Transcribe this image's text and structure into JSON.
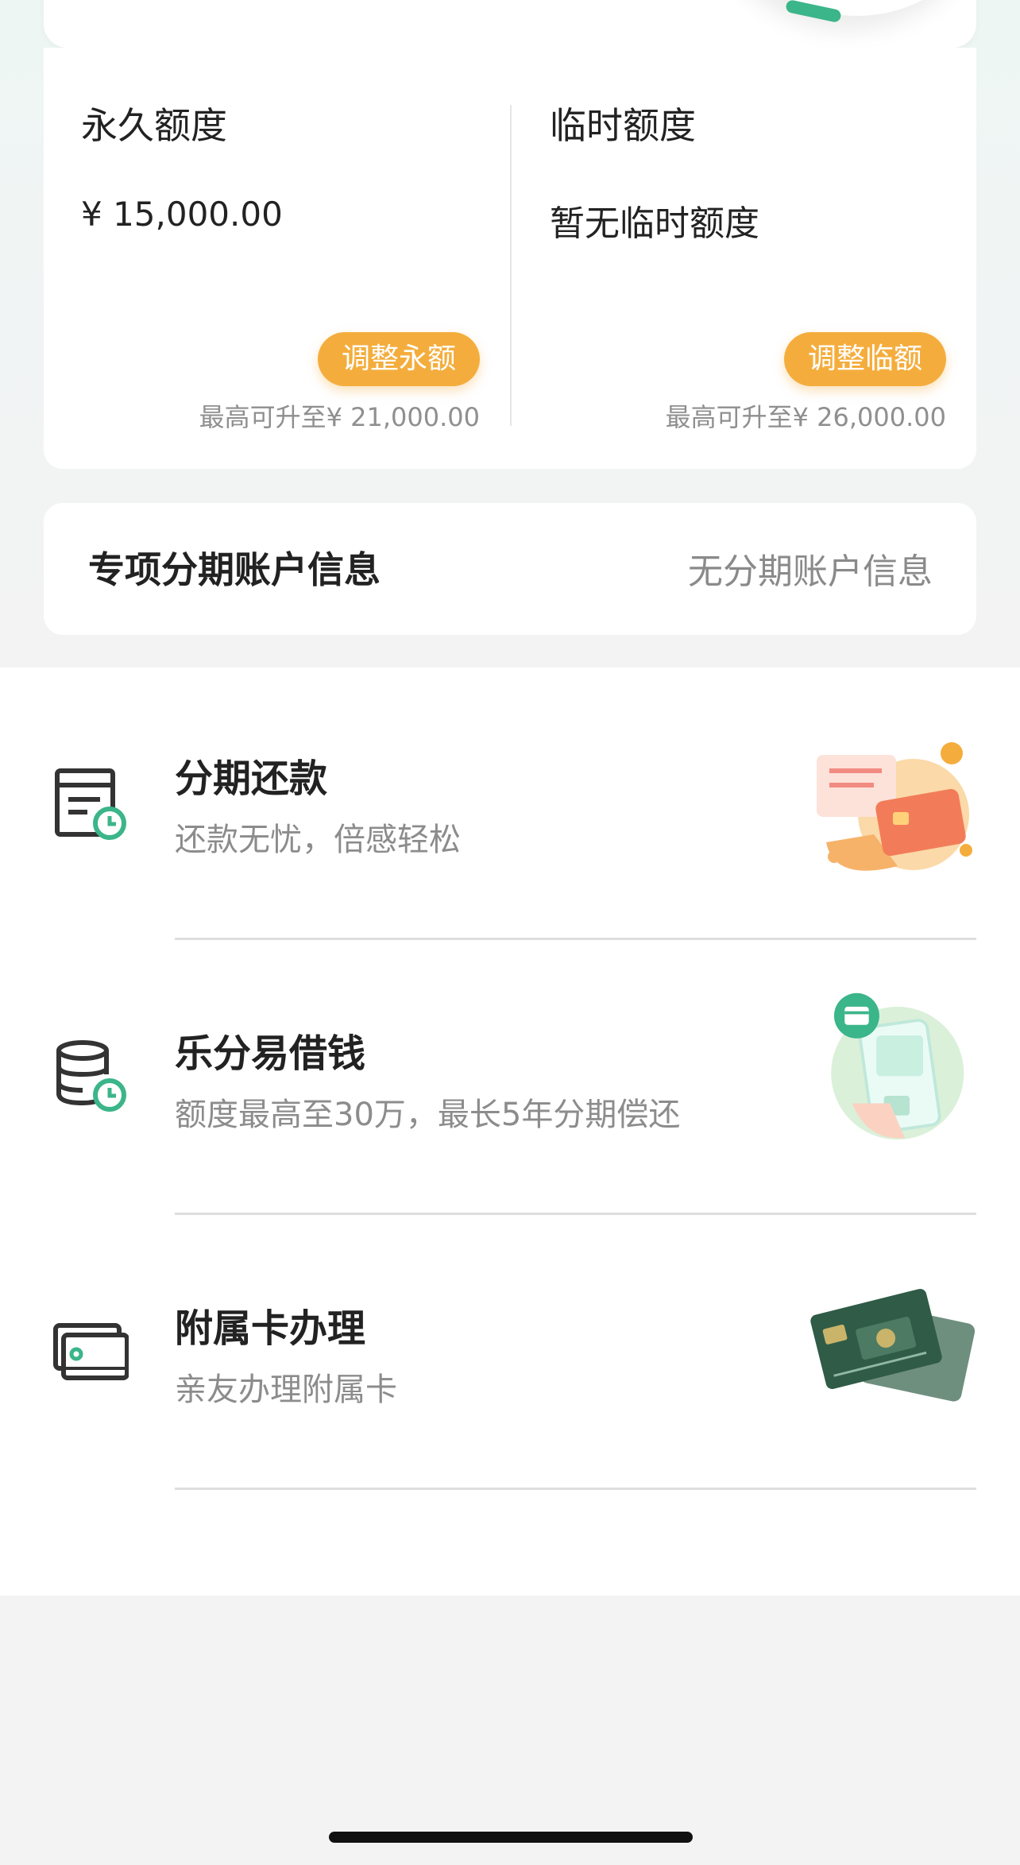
{
  "limits": {
    "permanent": {
      "title": "永久额度",
      "value": "¥ 15,000.00",
      "button": "调整永额",
      "max": "最高可升至¥ 21,000.00"
    },
    "temporary": {
      "title": "临时额度",
      "value": "暂无临时额度",
      "button": "调整临额",
      "max": "最高可升至¥ 26,000.00"
    }
  },
  "installment_account": {
    "title": "专项分期账户信息",
    "status": "无分期账户信息"
  },
  "services": [
    {
      "title": "分期还款",
      "subtitle": "还款无忧，倍感轻松",
      "icon": "bill-clock-icon"
    },
    {
      "title": "乐分易借钱",
      "subtitle": "额度最高至30万，最长5年分期偿还",
      "icon": "coins-clock-icon"
    },
    {
      "title": "附属卡办理",
      "subtitle": "亲友办理附属卡",
      "icon": "card-icon"
    }
  ],
  "colors": {
    "accent_orange": "#f4ad3d",
    "accent_green": "#3bb58a",
    "text_primary": "#222222",
    "text_secondary": "#8c8c8c"
  }
}
